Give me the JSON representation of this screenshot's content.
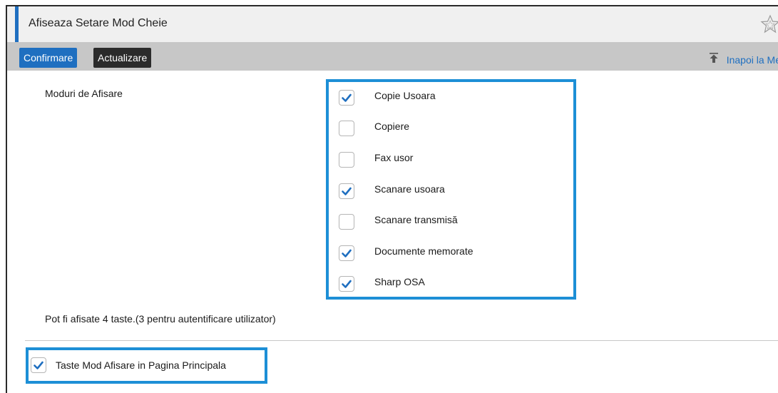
{
  "header": {
    "title": "Afiseaza Setare Mod Cheie",
    "favorite_icon": "star-outline-icon"
  },
  "toolbar": {
    "confirm_label": "Confirmare",
    "update_label": "Actualizare",
    "back_icon": "back-to-top-icon",
    "back_label": "Inapoi la Me"
  },
  "form": {
    "modes_label": "Moduri de Afisare",
    "modes": [
      {
        "label": "Copie Usoara",
        "checked": true
      },
      {
        "label": "Copiere",
        "checked": false
      },
      {
        "label": "Fax usor",
        "checked": false
      },
      {
        "label": "Scanare usoara",
        "checked": true
      },
      {
        "label": "Scanare transmisă",
        "checked": false
      },
      {
        "label": "Documente memorate",
        "checked": true
      },
      {
        "label": "Sharp OSA",
        "checked": true
      }
    ],
    "note": "Pot fi afisate 4 taste.(3 pentru autentificare utilizator)",
    "main_page_option": {
      "label": "Taste Mod Afisare in Pagina Principala",
      "checked": true
    }
  },
  "colors": {
    "accent": "#1f6fc0",
    "highlight_border": "#1d8fd6",
    "toolbar_bg": "#c7c7c7",
    "check_mark": "#1f6fc0"
  }
}
